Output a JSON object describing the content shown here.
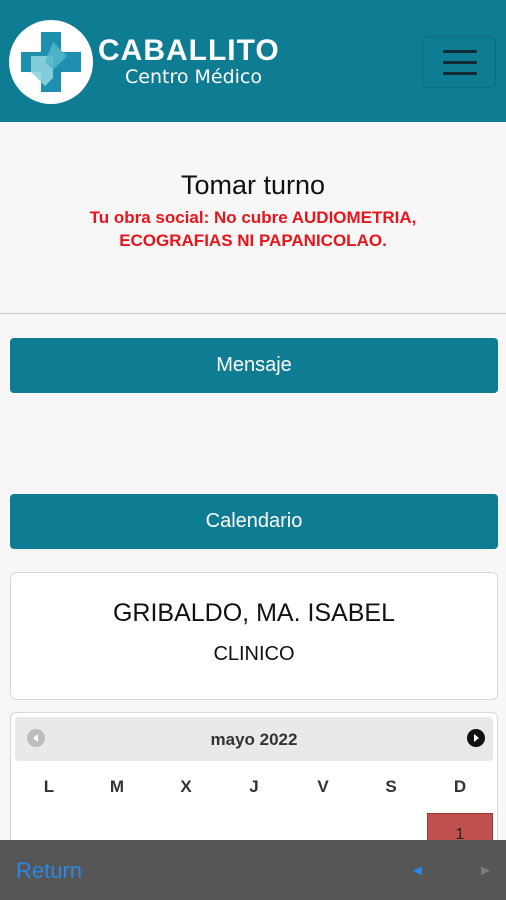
{
  "header": {
    "brand_name": "CABALLITO",
    "brand_sub": "Centro Médico",
    "logo_icon": "cross-logo-icon",
    "menu_icon": "hamburger-icon",
    "colors": {
      "primary": "#0e7c92",
      "logo_blue": "#1e8fae",
      "logo_light": "#8ed3df"
    }
  },
  "page": {
    "title": "Tomar turno",
    "warning": "Tu obra social: No cubre AUDIOMETRIA, ECOGRAFIAS NI PAPANICOLAO.",
    "warning_color": "#e8141b"
  },
  "buttons": {
    "mensaje": "Mensaje",
    "calendario": "Calendario"
  },
  "doctor": {
    "name": "GRIBALDO, MA. ISABEL",
    "specialty": "CLINICO"
  },
  "calendar": {
    "month": "mayo 2022",
    "prev_icon": "circle-arrow-left-icon",
    "next_icon": "circle-arrow-right-icon",
    "weekdays": [
      "L",
      "M",
      "X",
      "J",
      "V",
      "S",
      "D"
    ],
    "highlighted_day": "1",
    "highlight_color": "#c0504d"
  },
  "bottom_bar": {
    "return_label": "Return",
    "back_glyph": "◄",
    "forward_glyph": "►"
  }
}
